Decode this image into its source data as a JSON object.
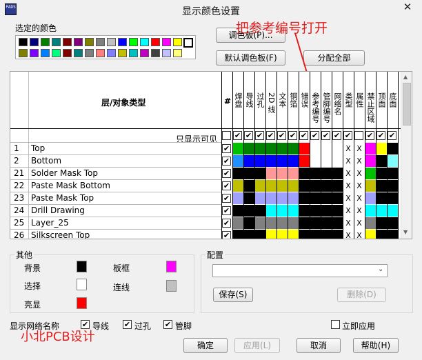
{
  "window": {
    "title": "显示颜色设置",
    "icon_text": "PADS",
    "close_label": "✕"
  },
  "annotation": {
    "text": "把参考编号打开",
    "watermark": "小北PCB设计",
    "color": "#e11e1e"
  },
  "palette": {
    "label": "选定的颜色",
    "row1": [
      "#000000",
      "#00007f",
      "#007f00",
      "#007f7f",
      "#7f0000",
      "#7f007f",
      "#7f7f00",
      "#7f7f7f",
      "#c0c0c0",
      "#0000ff",
      "#00ff00",
      "#00ffff",
      "#ff0000",
      "#ff00ff",
      "#ffff00",
      "#ffffff"
    ],
    "row2": [
      "#7f7f00",
      "#7f00ff",
      "#007fff",
      "#00ff7f",
      "#7f0000",
      "#007f7f",
      "#7f7f7f",
      "#ff7f7f",
      "#7f7fff",
      "#c0c000",
      "#00c0c0",
      "#c000c0",
      "#404040",
      "#c0c0ff",
      "#ffff7f"
    ]
  },
  "buttons": {
    "palette": "调色板(P)...",
    "default_palette": "默认调色板(F)",
    "assign_all": "分配全部",
    "save": "保存(S)",
    "delete": "删除(D)",
    "ok": "确定",
    "apply": "应用(L)",
    "cancel": "取消",
    "help": "帮助(H)"
  },
  "table": {
    "header_layer": "层/对象类型",
    "header_hash": "#",
    "columns": [
      "焊盘",
      "导线",
      "过孔",
      "2D 线",
      "文本",
      "铜箔",
      "错误",
      "参考编号",
      "管脚编号",
      "网络名",
      "类型",
      "属性",
      "禁止区域",
      "顶面",
      "底面"
    ],
    "visible_only_label": "只显示可见",
    "visible_checks": [
      false,
      true,
      true,
      true,
      true,
      true,
      true,
      true,
      true,
      true,
      true,
      true,
      false,
      true,
      true,
      true
    ],
    "rows": [
      {
        "num": "1",
        "name": "Top",
        "checked": true,
        "colors": [
          "#00c000",
          "#008000",
          "#008000",
          "#008000",
          "#008000",
          "#008000",
          "#ff0000",
          "#ffffff",
          "#ffffff",
          "#ffffff",
          "X",
          "X",
          "#ff00ff",
          "#ffff00",
          "#000000"
        ]
      },
      {
        "num": "2",
        "name": "Bottom",
        "checked": true,
        "colors": [
          "#1e90ff",
          "#0000ff",
          "#0000ff",
          "#0000ff",
          "#0000ff",
          "#0000ff",
          "#ff0000",
          "#ffffff",
          "#ffffff",
          "#ffffff",
          "X",
          "X",
          "#ff00ff",
          "#000000",
          "#80ffff"
        ]
      },
      {
        "num": "21",
        "name": "Solder Mask Top",
        "checked": true,
        "colors": [
          "#000000",
          "#000000",
          "#000000",
          "#ff9999",
          "#ff9999",
          "#ff9999",
          "#000000",
          "#000000",
          "#000000",
          "#000000",
          "X",
          "X",
          "#00c000",
          "#000000",
          "#000000"
        ]
      },
      {
        "num": "22",
        "name": "Paste Mask Bottom",
        "checked": true,
        "colors": [
          "#c0c000",
          "#000000",
          "#c0c000",
          "#c0c000",
          "#c0c000",
          "#c0c000",
          "#000000",
          "#000000",
          "#000000",
          "#000000",
          "X",
          "X",
          "#c0c000",
          "#000000",
          "#000000"
        ]
      },
      {
        "num": "23",
        "name": "Paste Mask Top",
        "checked": true,
        "colors": [
          "#a0a0ff",
          "#000000",
          "#a0a0ff",
          "#a0a0ff",
          "#a0a0ff",
          "#a0a0ff",
          "#000000",
          "#000000",
          "#000000",
          "#000000",
          "X",
          "X",
          "#a0a0ff",
          "#000000",
          "#000000"
        ]
      },
      {
        "num": "24",
        "name": "Drill Drawing",
        "checked": true,
        "colors": [
          "#000000",
          "#000000",
          "#000000",
          "#00ffff",
          "#00ffff",
          "#00ffff",
          "#000000",
          "#000000",
          "#000000",
          "#000000",
          "X",
          "X",
          "#00ffff",
          "#00ffff",
          "#00ffff"
        ]
      },
      {
        "num": "25",
        "name": "Layer_25",
        "checked": true,
        "colors": [
          "#808080",
          "#000000",
          "#808080",
          "#808080",
          "#808080",
          "#808080",
          "#000000",
          "#000000",
          "#000000",
          "#000000",
          "X",
          "X",
          "#808080",
          "#000000",
          "#000000"
        ]
      },
      {
        "num": "26",
        "name": "Silkscreen Top",
        "checked": true,
        "colors": [
          "#000000",
          "#000000",
          "#000000",
          "#ffff00",
          "#ffff00",
          "#ffff00",
          "#000000",
          "#000000",
          "#000000",
          "#000000",
          "X",
          "X",
          "#ffff00",
          "#000000",
          "#000000"
        ]
      }
    ]
  },
  "other": {
    "title": "其他",
    "background_label": "背景",
    "background_color": "#000000",
    "select_label": "选择",
    "select_color": "#ffffff",
    "highlight_label": "亮显",
    "highlight_color": "#ff0000",
    "board_label": "板框",
    "board_color": "#ff00ff",
    "connection_label": "连线",
    "connection_color": "#c0c0c0"
  },
  "config": {
    "title": "配置",
    "selected": ""
  },
  "bottom": {
    "net_names_label": "显示网络名称",
    "trace_label": "导线",
    "trace_checked": true,
    "via_label": "过孔",
    "via_checked": true,
    "pin_label": "管脚",
    "pin_checked": true,
    "apply_now_label": "立即应用",
    "apply_now_checked": false
  }
}
